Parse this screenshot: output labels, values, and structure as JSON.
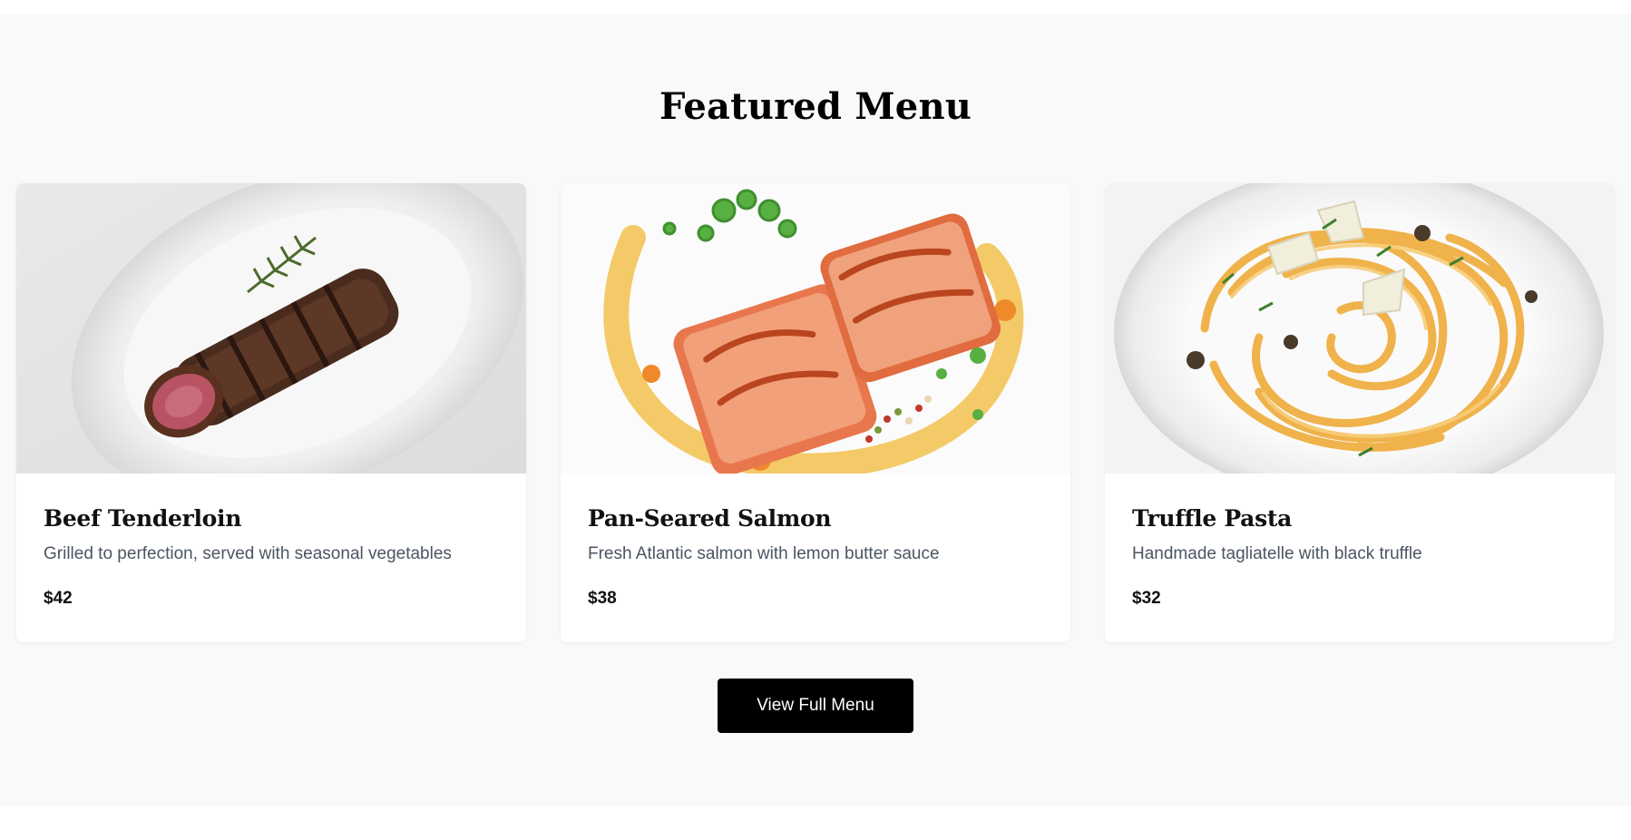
{
  "section": {
    "title": "Featured Menu"
  },
  "menu": {
    "items": [
      {
        "name": "Beef Tenderloin",
        "description": "Grilled to perfection, served with seasonal vegetables",
        "price": "$42"
      },
      {
        "name": "Pan-Seared Salmon",
        "description": "Fresh Atlantic salmon with lemon butter sauce",
        "price": "$38"
      },
      {
        "name": "Truffle Pasta",
        "description": "Handmade tagliatelle with black truffle",
        "price": "$32"
      }
    ]
  },
  "cta": {
    "label": "View Full Menu"
  },
  "colors": {
    "section_background": "#f8f9fb",
    "card_background": "#ffffff",
    "button_background": "#000000",
    "button_text": "#ffffff",
    "description_text": "#4b5563"
  }
}
